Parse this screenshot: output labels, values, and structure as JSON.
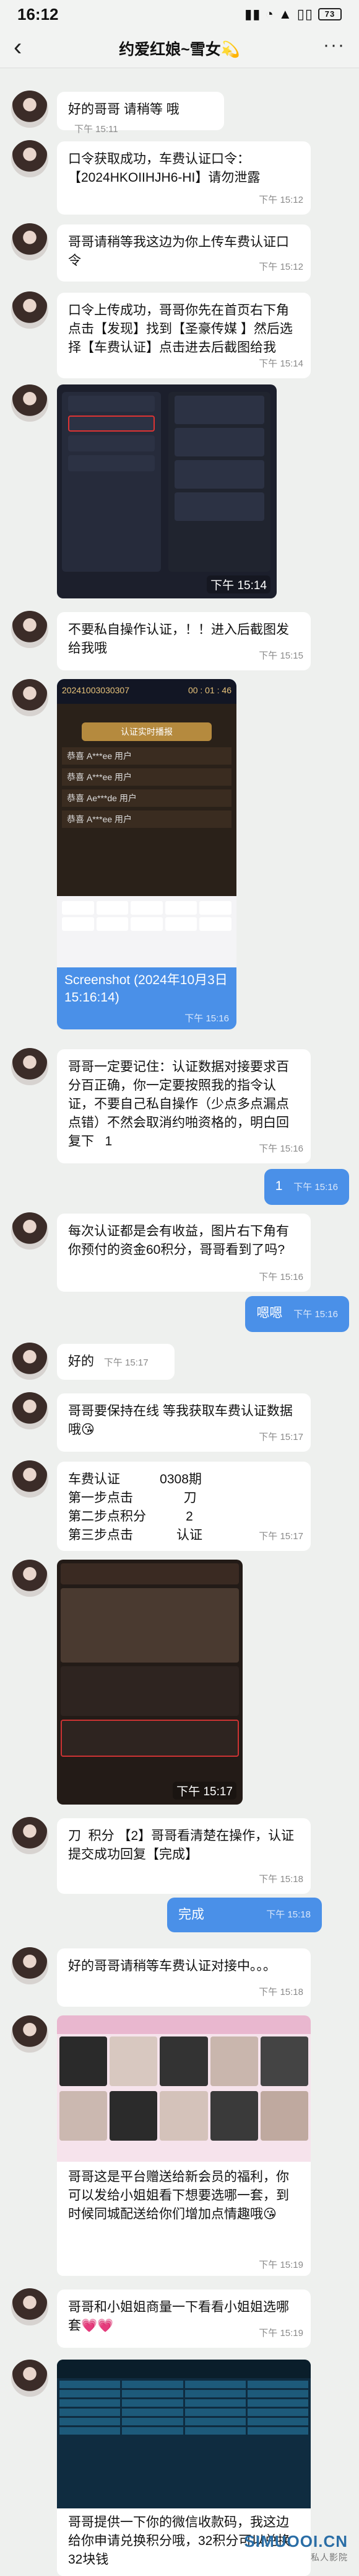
{
  "status": {
    "time": "16:12",
    "icons": "▮▮ ◔ ▲ ▯▯",
    "battery": "73"
  },
  "header": {
    "title": "约爱红娘~雪女💫"
  },
  "messages": {
    "m1": {
      "text": "好的哥哥  请稍等 哦",
      "time": "下午 15:11"
    },
    "m2": {
      "text": "口令获取成功，车费认证口令：【2024HKOIIHJH6-HI】请勿泄露",
      "time": "下午 15:12"
    },
    "m3": {
      "text": "哥哥请稍等我这边为你上传车费认证口令",
      "time": "下午 15:12"
    },
    "m4": {
      "text": "口令上传成功，哥哥你先在首页右下角点击【发现】找到【圣豪传媒 】然后选择【车费认证】点击进去后截图给我",
      "time": "下午 15:14"
    },
    "m5": {
      "time": "下午 15:14"
    },
    "m6": {
      "text": "不要私自操作认证，！！进入后截图发给我哦",
      "time": "下午 15:15"
    },
    "m7": {
      "caption": "Screenshot (2024年10月3日 15:16:14)",
      "time": "下午 15:16",
      "shot_title": "20241003030307",
      "shot_timer": "00 : 01 : 46",
      "confirm": "认证实时播报",
      "rows": [
        "恭喜 A***ee 用户",
        "恭喜 A***ee 用户",
        "恭喜 Ae***de 用户",
        "恭喜 A***ee 用户"
      ]
    },
    "m8": {
      "text": "哥哥一定要记住：认证数据对接要求百分百正确，你一定要按照我的指令认证，不要自己私自操作（少点多点漏点点错）不然会取消约啪资格的，明白回复下   1",
      "time": "下午 15:16"
    },
    "s1": {
      "text": "1",
      "time": "下午 15:16"
    },
    "m9": {
      "text": "每次认证都是会有收益，图片右下角有你预付的资金60积分，哥哥看到了吗?",
      "time": "下午 15:16"
    },
    "s2": {
      "text": "嗯嗯",
      "time": "下午 15:16"
    },
    "m10": {
      "text": "好的",
      "time": "下午 15:17"
    },
    "m11": {
      "text": "哥哥要保持在线 等我获取车费认证数据哦😘",
      "time": "下午 15:17"
    },
    "m12": {
      "text": "车费认证           0308期\n第一步点击              刀\n第二步点积分           2\n第三步点击            认证",
      "time": "下午 15:17"
    },
    "m13": {
      "time": "下午 15:17"
    },
    "m14": {
      "text": "刀  积分 【2】哥哥看清楚在操作，认证提交成功回复【完成】",
      "time": "下午 15:18"
    },
    "s3": {
      "text": "完成",
      "time": "下午 15:18"
    },
    "m15": {
      "text": "好的哥哥请稍等车费认证对接中。。。",
      "time": "下午 15:18"
    },
    "m16": {
      "text": "哥哥这是平台赠送给新会员的福利，你可以发给小姐姐看下想要选哪一套，到时候同城配送给你们增加点情趣哦😘",
      "time": "下午 15:19"
    },
    "m17": {
      "text": "哥哥和小姐姐商量一下看看小姐姐选哪套💗💗",
      "time": "下午 15:19"
    },
    "m18": {
      "text": "哥哥提供一下你的微信收款码，我这边给你申请兑换积分哦，32积分可以兑换32块钱",
      "time": ""
    }
  },
  "watermark": {
    "site": "SIMUOOI.CN",
    "sub": "私人影院"
  }
}
